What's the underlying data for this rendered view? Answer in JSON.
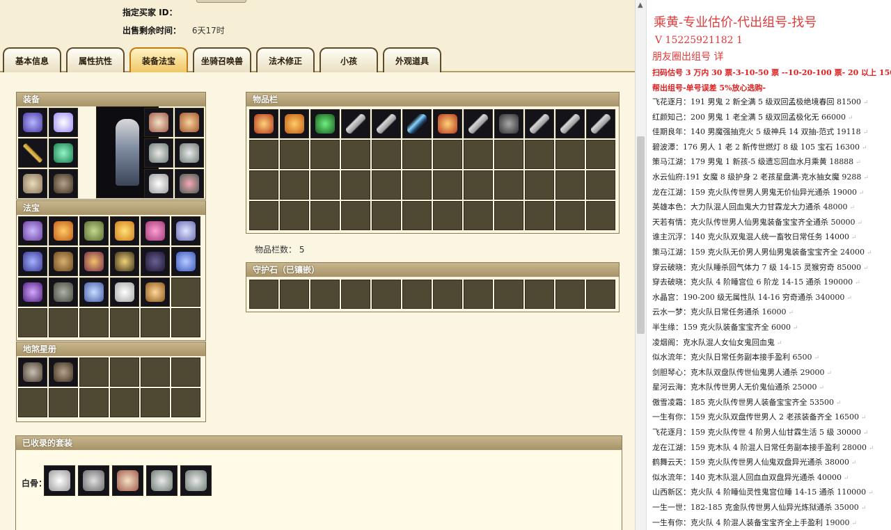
{
  "seller": {
    "buyer_id_label": "指定买家 ID：",
    "time_left_label": "出售剩余时间：",
    "time_left_value": "6天17时"
  },
  "tabs": [
    {
      "label": "基本信息"
    },
    {
      "label": "属性抗性"
    },
    {
      "label": "装备法宝"
    },
    {
      "label": "坐骑召唤兽"
    },
    {
      "label": "法术修正"
    },
    {
      "label": "小孩"
    },
    {
      "label": "外观道具"
    }
  ],
  "active_tab": "装备法宝",
  "panels": {
    "equipment_title": "装备",
    "treasure_title": "法宝",
    "star_title": "地煞星册",
    "inventory_title": "物品栏",
    "inventory_count_label": "物品栏数：",
    "inventory_count": "5",
    "guard_title": "守护石（已镶嵌）",
    "collected_title": "已收录的套装",
    "white_bone_label": "白骨："
  },
  "notes": {
    "title": "乘黄-专业估价-代出组号-找号",
    "phone": "V 15225921182  1",
    "circle": "朋友圈出组号   详",
    "price_line": "扫码估号 3 万内 30 票-3-10-50 票  --10-20-100 票- 20 以上 150",
    "note_line": "帮出组号-单号误差 5%放心选购-",
    "items": [
      "飞花逐月：191 男鬼 2 新全满 5 级双回孟极绝境春回 81500",
      "红颜知己：200 男鬼 1 老全满 5 级双回孟极化无 66000",
      "佳期良年：140 男魔强抽克火 5 级神兵 14 双抽-范式 19118",
      "碧波潭：176 男人 1 老 2 新传世燃灯 8 级 105 宝石 16300",
      "策马江湖：179 男鬼 1 新孩-5 级遗忘回血水月乘黄 18888",
      "水云仙府:191 女魔 8 级护身 2 老孩星盘满-克水抽女魔 9288",
      "龙在江湖：159 克火队传世男人男鬼无价仙异光通杀 19000",
      "英雄本色：大力队混人回血鬼大力甘霖龙大力通杀 48000",
      "天若有情：克火队传世男人仙男鬼装备宝宝齐全通杀 50000",
      "谁主沉浮：140 克火队双鬼混人统一畜牧日常任务 14000",
      "策马江湖：159 克火队无价男人男仙男鬼装备宝宝齐全 24000",
      "穿云破晓：克火队睡杀回气体力 7 级 14-15 灵猴穷奇 85000",
      "穿去破晓：克火队 4 阶睡宫位 6 阶龙 14-15 通杀 190000",
      "水晶宫：190-200 级无属性队 14-16 穷奇通杀 340000",
      "云水一梦：克火队日常任务通杀 16000",
      "半生缘：159 克火队装备宝宝齐全 6000",
      "凌烟阁：克水队混人女仙女鬼回血鬼",
      "似水流年：克火队日常任务副本接手盈利 6500",
      "剑胆琴心：克木队双盘队传世仙鬼男人通杀 29000",
      "星河云海：克木队传世男人无价鬼仙通杀 25000",
      "傲雪凌霜：185 克火队传世男人装备宝宝齐全 53500",
      "一生有你：159 克火队双盘传世男人 2 老孩装备齐全 16500",
      "飞花逐月：159 克火队传世 4 阶男人仙甘霖生活 5 级 30000",
      "龙在江湖：159 克木队 4 阶混人日常任务副本接手盈利 28000",
      "鹤舞云天：159 克火队传世男人仙鬼双盘异光通杀 38000",
      "似水流年：140 克木队混人回血血双盘异光通杀 40000",
      "山西新区：克火队 4 阶睡仙灵性鬼宫位睡 14-15 通杀 110000",
      "一生一世：182-185 克金队传世男人仙异光炼狱通杀 35000",
      "一生有你：克火队 4 阶混人装备宝宝齐全上手盈利 19000"
    ]
  },
  "icons": {
    "scroll_up": "▲"
  }
}
